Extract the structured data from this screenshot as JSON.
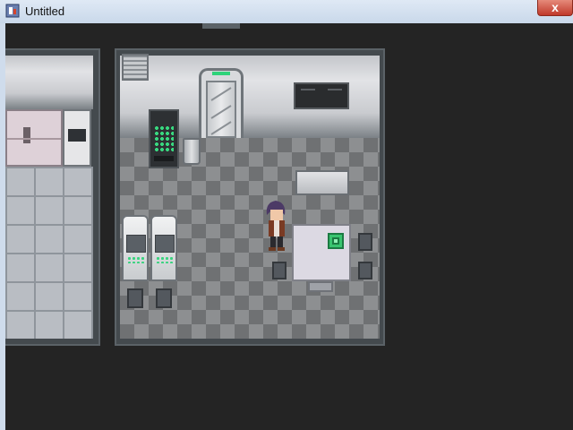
{
  "window": {
    "title": "Untitled",
    "close_glyph": "x"
  },
  "icons": {
    "app": "app-icon",
    "close": "close-icon"
  },
  "colors": {
    "background": "#242424",
    "floor_dark": "#6f7173",
    "floor_light": "#8d8f91",
    "accent_green": "#2fd37a"
  },
  "map": {
    "rooms": [
      "left-room",
      "main-room"
    ],
    "objects": [
      "vent",
      "sliding-door",
      "wall-screen",
      "vending-machine",
      "trash-bin",
      "bench",
      "table",
      "chip-item",
      "chairs",
      "pods",
      "kitchen-cabinets",
      "oven"
    ]
  }
}
